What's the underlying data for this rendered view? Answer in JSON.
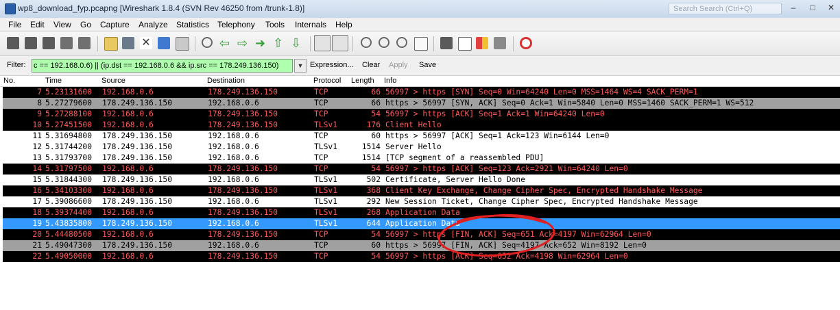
{
  "window": {
    "title": "wp8_download_fyp.pcapng   [Wireshark 1.8.4  (SVN Rev 46250 from /trunk-1.8)]",
    "search_placeholder": "Search Search (Ctrl+Q)",
    "minimize": "–",
    "maximize": "□",
    "close": "✕"
  },
  "menu": [
    "File",
    "Edit",
    "View",
    "Go",
    "Capture",
    "Analyze",
    "Statistics",
    "Telephony",
    "Tools",
    "Internals",
    "Help"
  ],
  "toolbar": {
    "buttons": [
      "interface-list-icon",
      "capture-options-icon",
      "start-capture-icon",
      "stop-capture-icon",
      "restart-capture-icon",
      "open-file-icon",
      "save-file-icon",
      "close-file-icon",
      "reload-icon",
      "print-icon",
      "find-packet-icon",
      "go-back-icon",
      "go-forward-icon",
      "go-to-packet-icon",
      "go-first-icon",
      "go-last-icon",
      "colorize-icon",
      "autoscroll-icon",
      "zoom-in-icon",
      "zoom-out-icon",
      "normal-size-icon",
      "resize-columns-icon",
      "capture-filters-icon",
      "display-filters-icon",
      "coloring-rules-icon",
      "preferences-icon",
      "help-icon"
    ]
  },
  "filter": {
    "label": "Filter:",
    "value": "c == 192.168.0.6) || (ip.dst == 192.168.0.6 && ip.src == 178.249.136.150)",
    "expression": "Expression...",
    "clear": "Clear",
    "apply": "Apply",
    "save": "Save"
  },
  "columns": [
    "No.",
    "Time",
    "Source",
    "Destination",
    "Protocol",
    "Length",
    "Info"
  ],
  "packets": [
    {
      "no": "7",
      "time": "5.23131600",
      "src": "192.168.0.6",
      "dst": "178.249.136.150",
      "proto": "TCP",
      "len": "66",
      "info": "56997 > https [SYN] Seq=0 Win=64240 Len=0 MSS=1464 WS=4 SACK_PERM=1",
      "style": "black"
    },
    {
      "no": "8",
      "time": "5.27279600",
      "src": "178.249.136.150",
      "dst": "192.168.0.6",
      "proto": "TCP",
      "len": "66",
      "info": "https > 56997 [SYN, ACK] Seq=0 Ack=1 Win=5840 Len=0 MSS=1460 SACK_PERM=1 WS=512",
      "style": "gray"
    },
    {
      "no": "9",
      "time": "5.27288100",
      "src": "192.168.0.6",
      "dst": "178.249.136.150",
      "proto": "TCP",
      "len": "54",
      "info": "56997 > https [ACK] Seq=1 Ack=1 Win=64240 Len=0",
      "style": "black"
    },
    {
      "no": "10",
      "time": "5.27451500",
      "src": "192.168.0.6",
      "dst": "178.249.136.150",
      "proto": "TLSv1",
      "len": "176",
      "info": "Client Hello",
      "style": "black"
    },
    {
      "no": "11",
      "time": "5.31694800",
      "src": "178.249.136.150",
      "dst": "192.168.0.6",
      "proto": "TCP",
      "len": "60",
      "info": "https > 56997 [ACK] Seq=1 Ack=123 Win=6144 Len=0",
      "style": "white"
    },
    {
      "no": "12",
      "time": "5.31744200",
      "src": "178.249.136.150",
      "dst": "192.168.0.6",
      "proto": "TLSv1",
      "len": "1514",
      "info": "Server Hello",
      "style": "white"
    },
    {
      "no": "13",
      "time": "5.31793700",
      "src": "178.249.136.150",
      "dst": "192.168.0.6",
      "proto": "TCP",
      "len": "1514",
      "info": "[TCP segment of a reassembled PDU]",
      "style": "white"
    },
    {
      "no": "14",
      "time": "5.31797500",
      "src": "192.168.0.6",
      "dst": "178.249.136.150",
      "proto": "TCP",
      "len": "54",
      "info": "56997 > https [ACK] Seq=123 Ack=2921 Win=64240 Len=0",
      "style": "black"
    },
    {
      "no": "15",
      "time": "5.31844300",
      "src": "178.249.136.150",
      "dst": "192.168.0.6",
      "proto": "TLSv1",
      "len": "502",
      "info": "Certificate, Server Hello Done",
      "style": "white"
    },
    {
      "no": "16",
      "time": "5.34103300",
      "src": "192.168.0.6",
      "dst": "178.249.136.150",
      "proto": "TLSv1",
      "len": "368",
      "info": "Client Key Exchange, Change Cipher Spec, Encrypted Handshake Message",
      "style": "black"
    },
    {
      "no": "17",
      "time": "5.39086600",
      "src": "178.249.136.150",
      "dst": "192.168.0.6",
      "proto": "TLSv1",
      "len": "292",
      "info": "New Session Ticket, Change Cipher Spec, Encrypted Handshake Message",
      "style": "white"
    },
    {
      "no": "18",
      "time": "5.39374400",
      "src": "192.168.0.6",
      "dst": "178.249.136.150",
      "proto": "TLSv1",
      "len": "268",
      "info": "Application Data",
      "style": "black"
    },
    {
      "no": "19",
      "time": "5.43835800",
      "src": "178.249.136.150",
      "dst": "192.168.0.6",
      "proto": "TLSv1",
      "len": "644",
      "info": "Application Data",
      "style": "selected"
    },
    {
      "no": "20",
      "time": "5.44480500",
      "src": "192.168.0.6",
      "dst": "178.249.136.150",
      "proto": "TCP",
      "len": "54",
      "info": "56997 > https [FIN, ACK] Seq=651 Ack=4197 Win=62964 Len=0",
      "style": "black"
    },
    {
      "no": "21",
      "time": "5.49047300",
      "src": "178.249.136.150",
      "dst": "192.168.0.6",
      "proto": "TCP",
      "len": "60",
      "info": "https > 56997 [FIN, ACK] Seq=4197 Ack=652 Win=8192 Len=0",
      "style": "gray"
    },
    {
      "no": "22",
      "time": "5.49050000",
      "src": "192.168.0.6",
      "dst": "178.249.136.150",
      "proto": "TCP",
      "len": "54",
      "info": "56997 > https [ACK] Seq=652 Ack=4198 Win=62964 Len=0",
      "style": "black"
    }
  ],
  "colors": {
    "filter_valid_bg": "#afffaf",
    "selected_row": "#3399ff",
    "bad_row_bg": "#000000",
    "bad_row_text": "#ff5a5a",
    "fin_row_bg": "#a0a0a0",
    "annotation": "#e02020"
  }
}
